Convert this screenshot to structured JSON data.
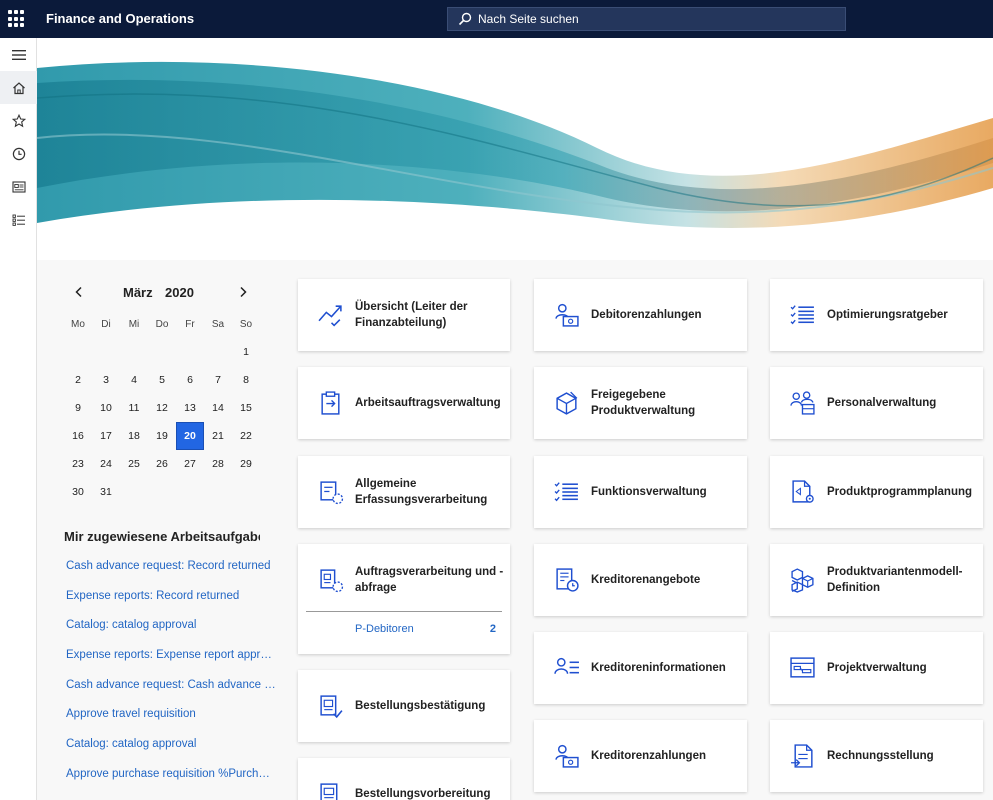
{
  "header": {
    "app_title": "Finance and Operations",
    "search_placeholder": "Nach Seite suchen"
  },
  "calendar": {
    "month": "März",
    "year": "2020",
    "weekdays": [
      "Mo",
      "Di",
      "Mi",
      "Do",
      "Fr",
      "Sa",
      "So"
    ],
    "leading_blanks": 6,
    "days": [
      "1",
      "2",
      "3",
      "4",
      "5",
      "6",
      "7",
      "8",
      "9",
      "10",
      "11",
      "12",
      "13",
      "14",
      "15",
      "16",
      "17",
      "18",
      "19",
      "20",
      "21",
      "22",
      "23",
      "24",
      "25",
      "26",
      "27",
      "28",
      "29",
      "30",
      "31"
    ],
    "selected_day": "20"
  },
  "tasks": {
    "title": "Mir zugewiesene Arbeitsaufgaben",
    "items": [
      "Cash advance request: Record returned",
      "Expense reports: Record returned",
      "Catalog: catalog approval",
      "Expense reports: Expense report approval",
      "Cash advance request: Cash advance ap...",
      "Approve travel requisition",
      "Catalog: catalog approval",
      "Approve purchase requisition %Purchas..."
    ]
  },
  "tiles": {
    "col1": [
      {
        "label": "Übersicht (Leiter der Finanzabteilung)",
        "icon": "trend-chart-icon"
      },
      {
        "label": "Arbeitsauftragsverwaltung",
        "icon": "clipboard-arrow-icon"
      },
      {
        "label": "Allgemeine Erfassungsverarbeitung",
        "icon": "journal-processing-icon"
      },
      {
        "label": "Auftragsverarbeitung und -abfrage",
        "icon": "order-processing-icon",
        "sub_label": "P-Debitoren",
        "sub_count": "2"
      },
      {
        "label": "Bestellungsbestätigung",
        "icon": "purchase-confirm-icon"
      },
      {
        "label": "Bestellungsvorbereitung",
        "icon": "purchase-prep-icon"
      }
    ],
    "col2": [
      {
        "label": "Debitorenzahlungen",
        "icon": "customer-payment-icon"
      },
      {
        "label": "Freigegebene Produktverwaltung",
        "icon": "product-box-icon"
      },
      {
        "label": "Funktionsverwaltung",
        "icon": "checklist-icon"
      },
      {
        "label": "Kreditorenangebote",
        "icon": "vendor-quote-icon"
      },
      {
        "label": "Kreditoreninformationen",
        "icon": "vendor-info-icon"
      },
      {
        "label": "Kreditorenzahlungen",
        "icon": "vendor-payment-icon"
      }
    ],
    "col3": [
      {
        "label": "Optimierungsratgeber",
        "icon": "checklist-icon"
      },
      {
        "label": "Personalverwaltung",
        "icon": "people-icon"
      },
      {
        "label": "Produktprogrammplanung",
        "icon": "document-gear-icon"
      },
      {
        "label": "Produktvariantenmodell-Definition",
        "icon": "cubes-icon"
      },
      {
        "label": "Projektverwaltung",
        "icon": "project-board-icon"
      },
      {
        "label": "Rechnungsstellung",
        "icon": "invoice-icon"
      }
    ]
  },
  "colors": {
    "topbar": "#0b1a3a",
    "accent": "#2266e3",
    "link": "#2266c4",
    "banner_teal": "#1f96a8",
    "banner_orange": "#e9a657"
  }
}
